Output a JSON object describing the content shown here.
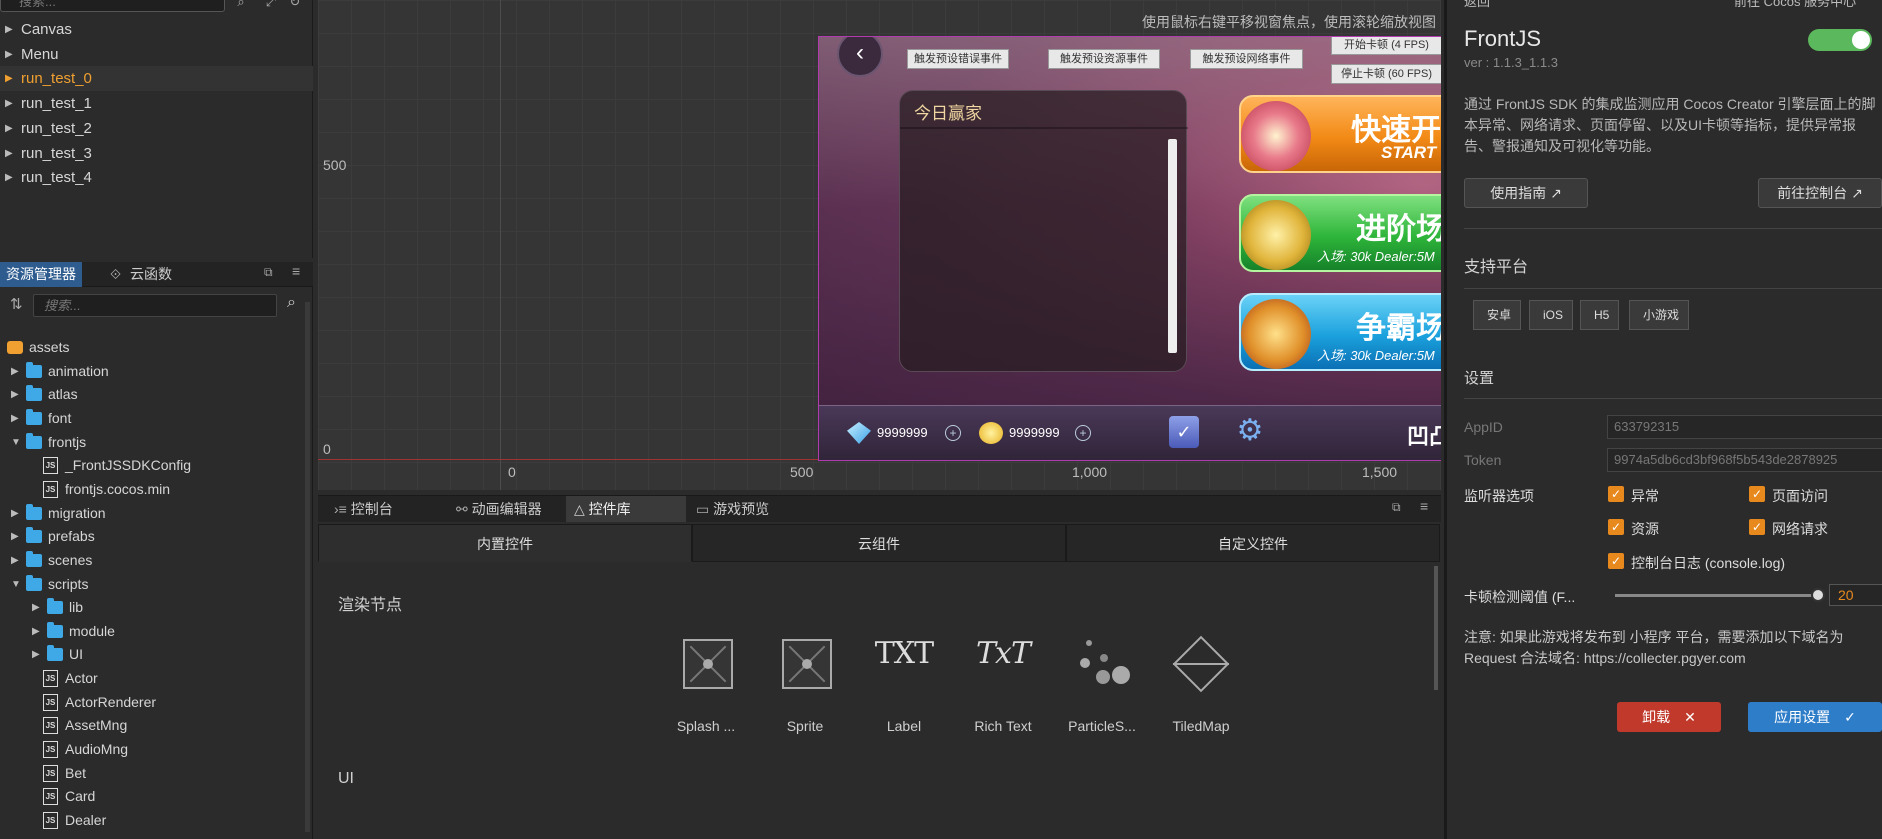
{
  "hierarchy": {
    "search_placeholder": "搜索...",
    "nodes": [
      {
        "label": "Canvas",
        "active": false
      },
      {
        "label": "Menu",
        "active": false
      },
      {
        "label": "run_test_0",
        "active": true
      },
      {
        "label": "run_test_1",
        "active": false
      },
      {
        "label": "run_test_2",
        "active": false
      },
      {
        "label": "run_test_3",
        "active": false
      },
      {
        "label": "run_test_4",
        "active": false
      }
    ]
  },
  "assets": {
    "tabs": [
      "资源管理器",
      "云函数"
    ],
    "search_placeholder": "搜索...",
    "items": [
      {
        "label": "assets",
        "type": "root"
      },
      {
        "label": "animation",
        "type": "folder"
      },
      {
        "label": "atlas",
        "type": "folder"
      },
      {
        "label": "font",
        "type": "folder"
      },
      {
        "label": "frontjs",
        "type": "folder-open"
      },
      {
        "label": "_FrontJSSDKConfig",
        "type": "js"
      },
      {
        "label": "frontjs.cocos.min",
        "type": "js"
      },
      {
        "label": "migration",
        "type": "folder"
      },
      {
        "label": "prefabs",
        "type": "folder"
      },
      {
        "label": "scenes",
        "type": "folder"
      },
      {
        "label": "scripts",
        "type": "folder-open"
      },
      {
        "label": "lib",
        "type": "folder"
      },
      {
        "label": "module",
        "type": "folder"
      },
      {
        "label": "UI",
        "type": "folder"
      },
      {
        "label": "Actor",
        "type": "js"
      },
      {
        "label": "ActorRenderer",
        "type": "js"
      },
      {
        "label": "AssetMng",
        "type": "js"
      },
      {
        "label": "AudioMng",
        "type": "js"
      },
      {
        "label": "Bet",
        "type": "js"
      },
      {
        "label": "Card",
        "type": "js"
      },
      {
        "label": "Dealer",
        "type": "js"
      }
    ]
  },
  "scene": {
    "hint": "使用鼠标右键平移视窗焦点，使用滚轮缩放视图",
    "y_ticks": [
      "500",
      "0"
    ],
    "x_ticks": [
      "0",
      "500",
      "1,000",
      "1,500"
    ],
    "game": {
      "test_buttons": [
        "触发预设错误事件",
        "触发预设资源事件",
        "触发预设网络事件"
      ],
      "fps_buttons": [
        "开始卡顿 (4 FPS)",
        "停止卡顿 (60 FPS)"
      ],
      "winners_title": "今日赢家",
      "quick_start": {
        "title": "快速开始",
        "sub": "START"
      },
      "advanced": {
        "title": "进阶场",
        "sub": "入场: 30k   Dealer:5M"
      },
      "champion": {
        "title": "争霸场",
        "sub": "入场: 30k   Dealer:5M"
      },
      "gems": "9999999",
      "coins": "9999999",
      "player_name": "凹凸曼",
      "back_icon": "‹",
      "mail_icon": "✉",
      "plus_glyph": "+"
    }
  },
  "bottom_panel": {
    "tabs": [
      "控制台",
      "动画编辑器",
      "控件库",
      "游戏预览"
    ],
    "control_tabs": [
      "内置控件",
      "云组件",
      "自定义控件"
    ],
    "section_render": "渲染节点",
    "section_ui": "UI",
    "widgets": [
      "Splash ...",
      "Sprite",
      "Label",
      "Rich Text",
      "ParticleS...",
      "TiledMap"
    ]
  },
  "inspector": {
    "top_left": "返回",
    "top_right": "前往 Cocos 服务中心",
    "title": "FrontJS",
    "version": "ver : 1.1.3_1.1.3",
    "enabled": true,
    "description": "通过 FrontJS SDK 的集成监测应用 Cocos Creator 引擎层面上的脚本异常、网络请求、页面停留、以及UI卡顿等指标，提供异常报告、警报通知及可视化等功能。",
    "guide_button": "使用指南",
    "console_button": "前往控制台",
    "platforms_title": "支持平台",
    "platforms": [
      "安卓",
      "iOS",
      "H5",
      "小游戏"
    ],
    "settings_title": "设置",
    "appid_label": "AppID",
    "appid_value": "633792315",
    "token_label": "Token",
    "token_value": "9974a5db6cd3bf968f5b543de2878925",
    "listener_label": "监听器选项",
    "listeners": [
      "异常",
      "页面访问",
      "资源",
      "网络请求",
      "控制台日志 (console.log)"
    ],
    "threshold_label": "卡顿检测阈值 (F...",
    "threshold_value": "20",
    "note": "注意: 如果此游戏将发布到 小程序 平台，需要添加以下域名为 Request 合法域名: https://collecter.pgyer.com",
    "uninstall_button": "卸载",
    "apply_button": "应用设置",
    "colors": {
      "accent": "#e8891e",
      "toggle": "#5cb85c",
      "danger": "#c0392b",
      "primary": "#2e7dc9"
    }
  }
}
